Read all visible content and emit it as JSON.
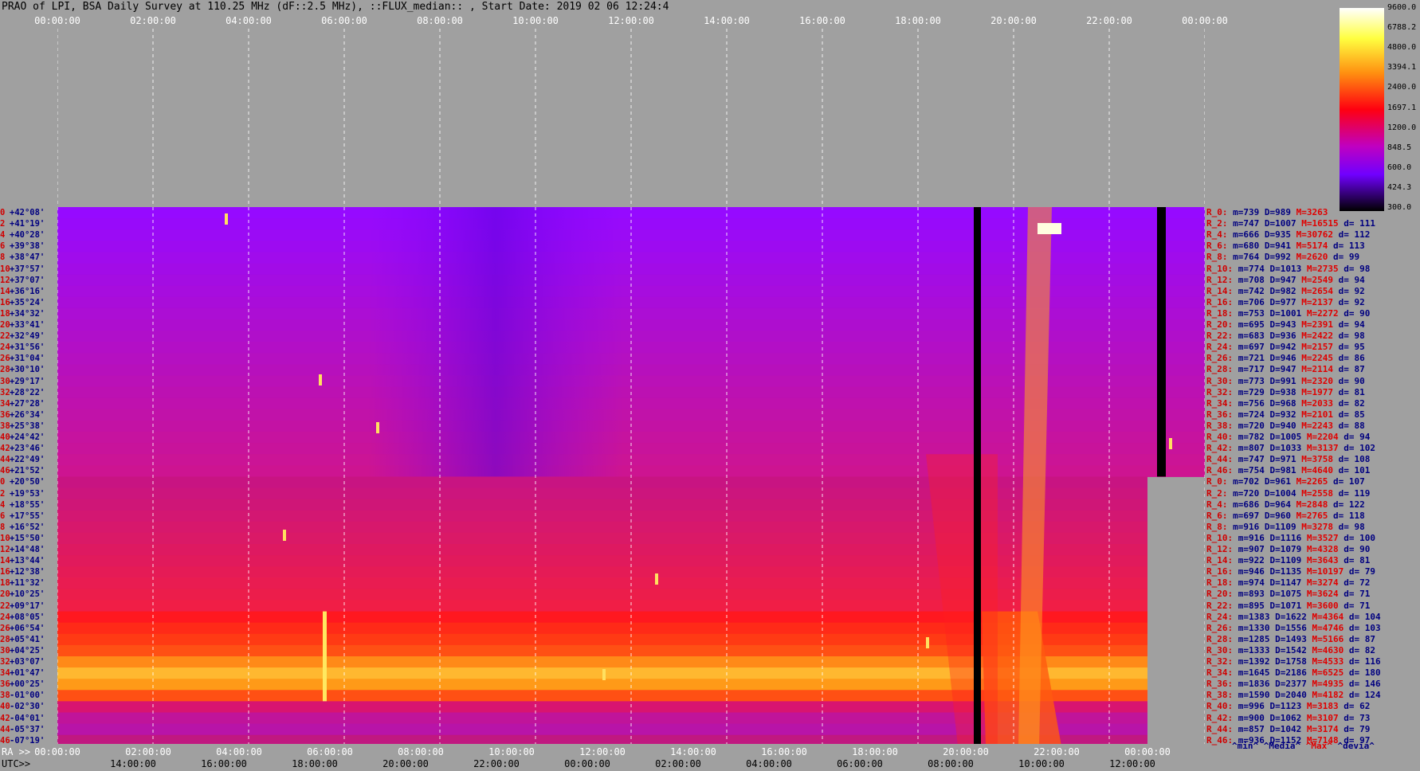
{
  "title": "PRAO of LPI, BSA Daily Survey at 110.25 MHz (dF::2.5 MHz), ::FLUX_median:: , Start Date: 2019 02 06 12:24:4",
  "chart_data": {
    "type": "heatmap",
    "top_ticks": [
      "00:00:00",
      "02:00:00",
      "04:00:00",
      "06:00:00",
      "08:00:00",
      "10:00:00",
      "12:00:00",
      "14:00:00",
      "16:00:00",
      "18:00:00",
      "20:00:00",
      "22:00:00",
      "00:00:00"
    ],
    "bottom_ra_label": "RA >>",
    "bottom_ra_ticks": [
      "00:00:00",
      "02:00:00",
      "04:00:00",
      "06:00:00",
      "08:00:00",
      "10:00:00",
      "12:00:00",
      "14:00:00",
      "16:00:00",
      "18:00:00",
      "20:00:00",
      "22:00:00",
      "00:00:00"
    ],
    "bottom_utc_label": "UTC>>",
    "bottom_utc_ticks": [
      "14:00:00",
      "16:00:00",
      "18:00:00",
      "20:00:00",
      "22:00:00",
      "00:00:00",
      "02:00:00",
      "04:00:00",
      "06:00:00",
      "08:00:00",
      "10:00:00",
      "12:00:00"
    ],
    "colorbar_ticks": [
      "9600.0",
      "6788.2",
      "4800.0",
      "3394.1",
      "2400.0",
      "1697.1",
      "1200.0",
      "848.5",
      "600.0",
      "424.3",
      "300.0"
    ],
    "row_index": [
      "0",
      "2",
      "4",
      "6",
      "8",
      "10",
      "12",
      "14",
      "16",
      "18",
      "20",
      "22",
      "24",
      "26",
      "28",
      "30",
      "32",
      "34",
      "36",
      "38",
      "40",
      "42",
      "44",
      "46",
      "0",
      "2",
      "4",
      "6",
      "8",
      "10",
      "12",
      "14",
      "16",
      "18",
      "20",
      "22",
      "24",
      "26",
      "28",
      "30",
      "32",
      "34",
      "36",
      "38",
      "40",
      "42",
      "44",
      "46"
    ],
    "declinations": [
      "+42°08'",
      "+41°19'",
      "+40°28'",
      "+39°38'",
      "+38°47'",
      "+37°57'",
      "+37°07'",
      "+36°16'",
      "+35°24'",
      "+34°32'",
      "+33°41'",
      "+32°49'",
      "+31°56'",
      "+31°04'",
      "+30°10'",
      "+29°17'",
      "+28°22'",
      "+27°28'",
      "+26°34'",
      "+25°38'",
      "+24°42'",
      "+23°46'",
      "+22°49'",
      "+21°52'",
      "+20°50'",
      "+19°53'",
      "+18°55'",
      "+17°55'",
      "+16°52'",
      "+15°50'",
      "+14°48'",
      "+13°44'",
      "+12°38'",
      "+11°32'",
      "+10°25'",
      "+09°17'",
      "+08°05'",
      "+06°54'",
      "+05°41'",
      "+04°25'",
      "+03°07'",
      "+01°47'",
      "+00°25'",
      "-01°00'",
      "-02°30'",
      "-04°01'",
      "-05°37'",
      "-07°19'"
    ],
    "stats": [
      {
        "r": "R_0:",
        "m": "m=739",
        "d": "D=989",
        "mx": "M=3263",
        "dv": ""
      },
      {
        "r": "R_2:",
        "m": "m=747",
        "d": "D=1007",
        "mx": "M=16515",
        "dv": "d= 111"
      },
      {
        "r": "R_4:",
        "m": "m=666",
        "d": "D=935",
        "mx": "M=30762",
        "dv": "d= 112"
      },
      {
        "r": "R_6:",
        "m": "m=680",
        "d": "D=941",
        "mx": "M=5174",
        "dv": "d= 113"
      },
      {
        "r": "R_8:",
        "m": "m=764",
        "d": "D=992",
        "mx": "M=2620",
        "dv": "d= 99"
      },
      {
        "r": "R_10:",
        "m": "m=774",
        "d": "D=1013",
        "mx": "M=2735",
        "dv": "d= 98"
      },
      {
        "r": "R_12:",
        "m": "m=708",
        "d": "D=947",
        "mx": "M=2549",
        "dv": "d= 94"
      },
      {
        "r": "R_14:",
        "m": "m=742",
        "d": "D=982",
        "mx": "M=2654",
        "dv": "d= 92"
      },
      {
        "r": "R_16:",
        "m": "m=706",
        "d": "D=977",
        "mx": "M=2137",
        "dv": "d= 92"
      },
      {
        "r": "R_18:",
        "m": "m=753",
        "d": "D=1001",
        "mx": "M=2272",
        "dv": "d= 90"
      },
      {
        "r": "R_20:",
        "m": "m=695",
        "d": "D=943",
        "mx": "M=2391",
        "dv": "d= 94"
      },
      {
        "r": "R_22:",
        "m": "m=683",
        "d": "D=936",
        "mx": "M=2422",
        "dv": "d= 98"
      },
      {
        "r": "R_24:",
        "m": "m=697",
        "d": "D=942",
        "mx": "M=2157",
        "dv": "d= 95"
      },
      {
        "r": "R_26:",
        "m": "m=721",
        "d": "D=946",
        "mx": "M=2245",
        "dv": "d= 86"
      },
      {
        "r": "R_28:",
        "m": "m=717",
        "d": "D=947",
        "mx": "M=2114",
        "dv": "d= 87"
      },
      {
        "r": "R_30:",
        "m": "m=773",
        "d": "D=991",
        "mx": "M=2320",
        "dv": "d= 90"
      },
      {
        "r": "R_32:",
        "m": "m=729",
        "d": "D=938",
        "mx": "M=1977",
        "dv": "d= 81"
      },
      {
        "r": "R_34:",
        "m": "m=756",
        "d": "D=968",
        "mx": "M=2033",
        "dv": "d= 82"
      },
      {
        "r": "R_36:",
        "m": "m=724",
        "d": "D=932",
        "mx": "M=2101",
        "dv": "d= 85"
      },
      {
        "r": "R_38:",
        "m": "m=720",
        "d": "D=940",
        "mx": "M=2243",
        "dv": "d= 88"
      },
      {
        "r": "R_40:",
        "m": "m=782",
        "d": "D=1005",
        "mx": "M=2204",
        "dv": "d= 94"
      },
      {
        "r": "R_42:",
        "m": "m=807",
        "d": "D=1033",
        "mx": "M=3137",
        "dv": "d= 102"
      },
      {
        "r": "R_44:",
        "m": "m=747",
        "d": "D=971",
        "mx": "M=3758",
        "dv": "d= 108"
      },
      {
        "r": "R_46:",
        "m": "m=754",
        "d": "D=981",
        "mx": "M=4640",
        "dv": "d= 101"
      },
      {
        "r": "R_0:",
        "m": "m=702",
        "d": "D=961",
        "mx": "M=2265",
        "dv": "d= 107"
      },
      {
        "r": "R_2:",
        "m": "m=720",
        "d": "D=1004",
        "mx": "M=2558",
        "dv": "d= 119"
      },
      {
        "r": "R_4:",
        "m": "m=686",
        "d": "D=964",
        "mx": "M=2848",
        "dv": "d= 122"
      },
      {
        "r": "R_6:",
        "m": "m=697",
        "d": "D=960",
        "mx": "M=2765",
        "dv": "d= 118"
      },
      {
        "r": "R_8:",
        "m": "m=916",
        "d": "D=1109",
        "mx": "M=3278",
        "dv": "d= 98"
      },
      {
        "r": "R_10:",
        "m": "m=916",
        "d": "D=1116",
        "mx": "M=3527",
        "dv": "d= 100"
      },
      {
        "r": "R_12:",
        "m": "m=907",
        "d": "D=1079",
        "mx": "M=4328",
        "dv": "d= 90"
      },
      {
        "r": "R_14:",
        "m": "m=922",
        "d": "D=1109",
        "mx": "M=3643",
        "dv": "d= 81"
      },
      {
        "r": "R_16:",
        "m": "m=946",
        "d": "D=1135",
        "mx": "M=10197",
        "dv": "d= 79"
      },
      {
        "r": "R_18:",
        "m": "m=974",
        "d": "D=1147",
        "mx": "M=3274",
        "dv": "d= 72"
      },
      {
        "r": "R_20:",
        "m": "m=893",
        "d": "D=1075",
        "mx": "M=3624",
        "dv": "d= 71"
      },
      {
        "r": "R_22:",
        "m": "m=895",
        "d": "D=1071",
        "mx": "M=3600",
        "dv": "d= 71"
      },
      {
        "r": "R_24:",
        "m": "m=1383",
        "d": "D=1622",
        "mx": "M=4364",
        "dv": "d= 104"
      },
      {
        "r": "R_26:",
        "m": "m=1330",
        "d": "D=1556",
        "mx": "M=4746",
        "dv": "d= 103"
      },
      {
        "r": "R_28:",
        "m": "m=1285",
        "d": "D=1493",
        "mx": "M=5166",
        "dv": "d= 87"
      },
      {
        "r": "R_30:",
        "m": "m=1333",
        "d": "D=1542",
        "mx": "M=4630",
        "dv": "d= 82"
      },
      {
        "r": "R_32:",
        "m": "m=1392",
        "d": "D=1758",
        "mx": "M=4533",
        "dv": "d= 116"
      },
      {
        "r": "R_34:",
        "m": "m=1645",
        "d": "D=2186",
        "mx": "M=6525",
        "dv": "d= 180"
      },
      {
        "r": "R_36:",
        "m": "m=1836",
        "d": "D=2377",
        "mx": "M=4935",
        "dv": "d= 146"
      },
      {
        "r": "R_38:",
        "m": "m=1590",
        "d": "D=2040",
        "mx": "M=4182",
        "dv": "d= 124"
      },
      {
        "r": "R_40:",
        "m": "m=996",
        "d": "D=1123",
        "mx": "M=3183",
        "dv": "d= 62"
      },
      {
        "r": "R_42:",
        "m": "m=900",
        "d": "D=1062",
        "mx": "M=3107",
        "dv": "d= 73"
      },
      {
        "r": "R_44:",
        "m": "m=857",
        "d": "D=1042",
        "mx": "M=3174",
        "dv": "d= 79"
      },
      {
        "r": "R_46:",
        "m": "m=936",
        "d": "D=1152",
        "mx": "M=7148",
        "dv": "d= 97"
      }
    ],
    "stat_legend": {
      "min": "^min^",
      "median": "^Media^",
      "max": "^Max^",
      "devia": "^devia^"
    },
    "colors": {
      "background": "#a0a0a0",
      "low": "#000000",
      "mid": "#8000ff",
      "high": "#ff0000",
      "peak": "#ffffff"
    }
  }
}
